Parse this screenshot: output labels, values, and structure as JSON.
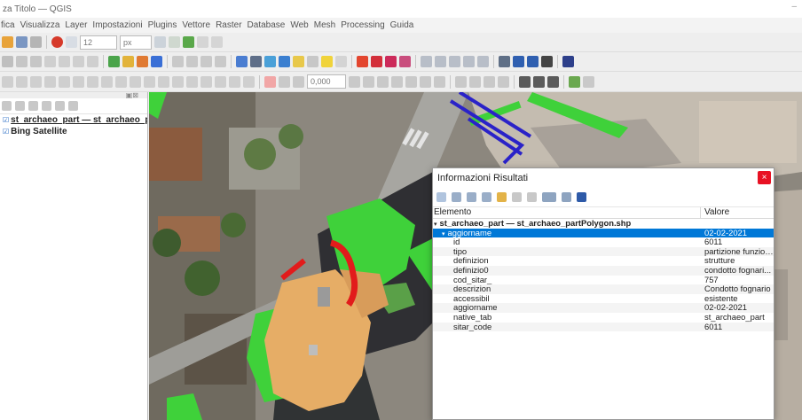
{
  "window": {
    "title": "za Titolo — QGIS"
  },
  "menu": [
    "fica",
    "Visualizza",
    "Layer",
    "Impostazioni",
    "Plugins",
    "Vettore",
    "Raster",
    "Database",
    "Web",
    "Mesh",
    "Processing",
    "Guida"
  ],
  "toolbar": {
    "font_size": "12",
    "unit": "px",
    "scale": "0,000"
  },
  "layers_panel": {
    "items": [
      {
        "label": "st_archaeo_part — st_archaeo_partPolygon.shp"
      },
      {
        "label": "Bing Satellite"
      }
    ]
  },
  "identify": {
    "title": "Informazioni Risultati",
    "close_glyph": "×",
    "columns": [
      "Elemento",
      "Valore"
    ],
    "layer_row": "st_archaeo_part — st_archaeo_partPolygon.shp",
    "feature": {
      "name": "aggiorname",
      "value": "02-02-2021"
    },
    "attributes": [
      {
        "name": "id",
        "value": "6011"
      },
      {
        "name": "tipo",
        "value": "partizione funzion..."
      },
      {
        "name": "definizion",
        "value": "strutture"
      },
      {
        "name": "definizio0",
        "value": "condotto fognari..."
      },
      {
        "name": "cod_sitar_",
        "value": "757"
      },
      {
        "name": "descrizion",
        "value": "Condotto fognario"
      },
      {
        "name": "accessibil",
        "value": "esistente"
      },
      {
        "name": "aggiorname",
        "value": "02-02-2021"
      },
      {
        "name": "native_tab",
        "value": "st_archaeo_part"
      },
      {
        "name": "sitar_code",
        "value": "6011"
      }
    ]
  },
  "colors": {
    "selection": "#0078d7",
    "close": "#e81123",
    "polygon_tan": "#e6ad66",
    "polygon_green": "#3fd13a",
    "highlight_red": "#e21b1b",
    "outline_blue": "#2a22c8"
  }
}
